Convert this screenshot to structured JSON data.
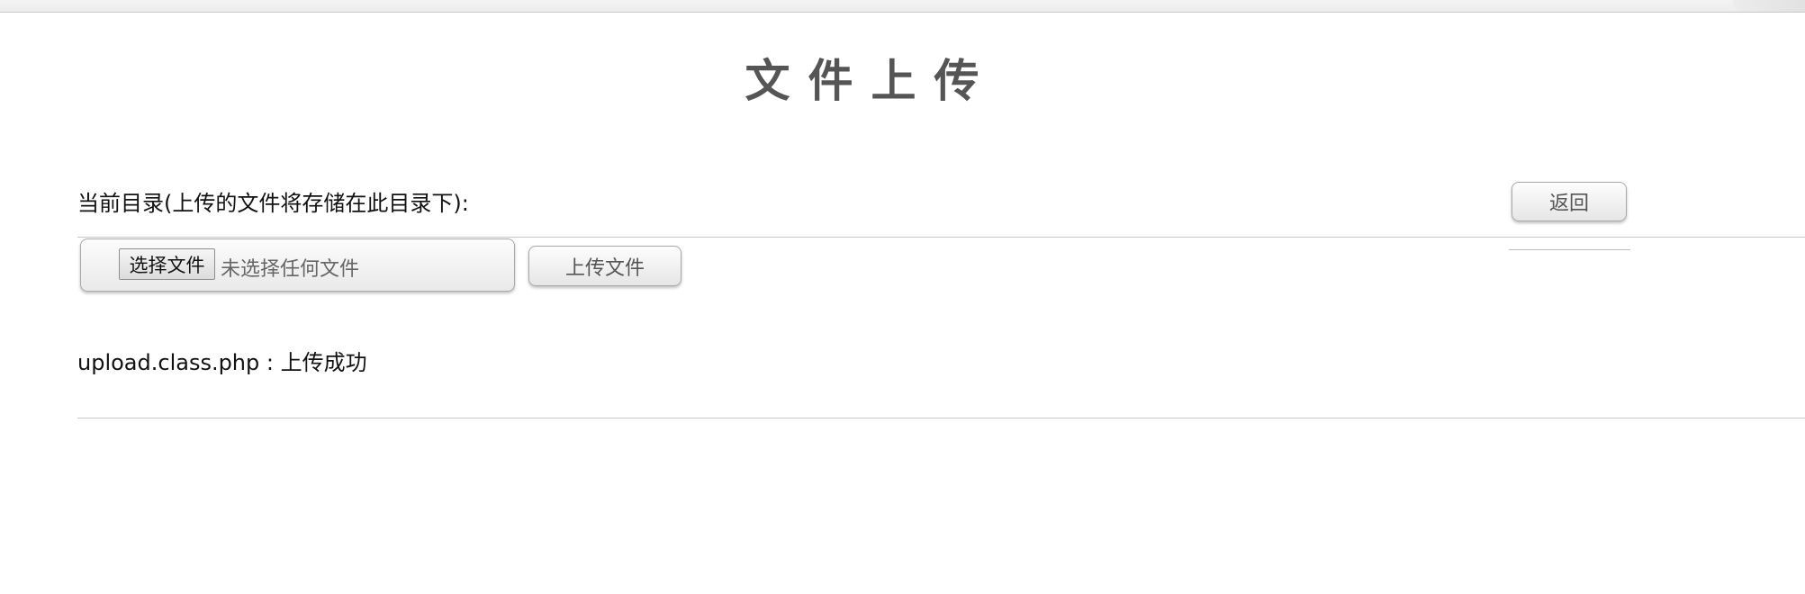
{
  "page": {
    "title": "文件上传",
    "directory_label": "当前目录(上传的文件将存储在此目录下):",
    "back_label": "返回"
  },
  "upload_form": {
    "choose_file_label": "选择文件",
    "no_file_text": "未选择任何文件",
    "upload_label": "上传文件"
  },
  "result": {
    "message": "upload.class.php : 上传成功"
  },
  "colors": {
    "title": "#555555",
    "divider": "#c8c8c8",
    "button_border": "#a9a9a9"
  }
}
